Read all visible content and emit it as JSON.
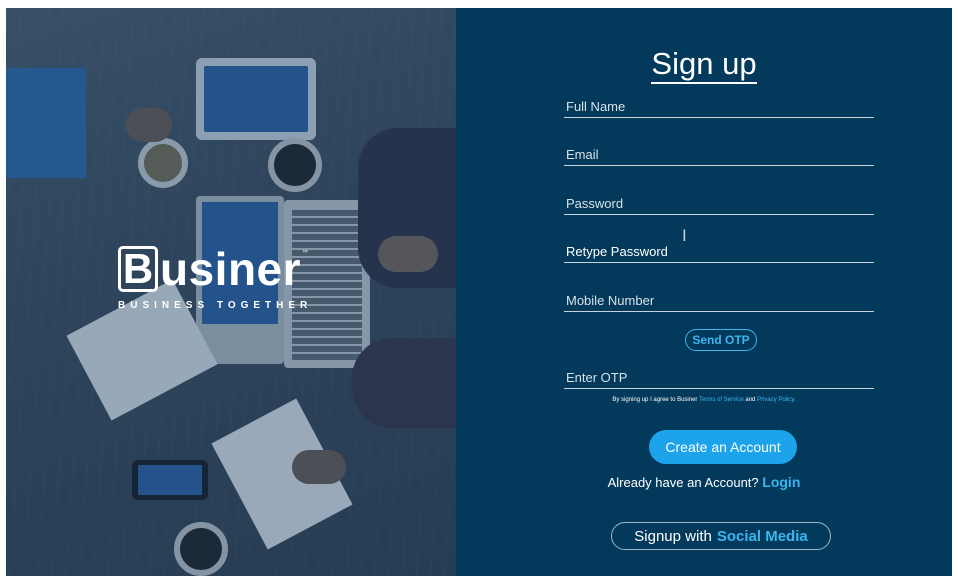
{
  "brand": {
    "logo_letter": "B",
    "logo_rest": "usiner",
    "trademark": "™",
    "tagline": "BUSINESS TOGETHER"
  },
  "form": {
    "title": "Sign up",
    "fields": {
      "full_name": {
        "placeholder": "Full Name",
        "value": ""
      },
      "email": {
        "placeholder": "Email",
        "value": ""
      },
      "password": {
        "placeholder": "Password",
        "value": ""
      },
      "retype_password": {
        "placeholder": "Retype Password",
        "value": ""
      },
      "mobile_number": {
        "placeholder": "Mobile Number",
        "value": ""
      },
      "otp": {
        "placeholder": "Enter OTP",
        "value": ""
      }
    },
    "send_otp_label": "Send OTP",
    "terms": {
      "prefix": "By signing up I agree to Businer",
      "terms_link": "Terms of Service",
      "and": "and",
      "privacy_link": "Privacy Policy."
    },
    "create_account_label": "Create an Account",
    "already_text": "Already have an Account?",
    "login_label": "Login",
    "social_prefix": "Signup with",
    "social_label": "Social Media"
  },
  "colors": {
    "panel_background": "#033a5b",
    "accent": "#3db5ef",
    "primary_button": "#1ca3ea",
    "text": "#ffffff"
  },
  "icons": {
    "text_cursor": "I-beam"
  }
}
